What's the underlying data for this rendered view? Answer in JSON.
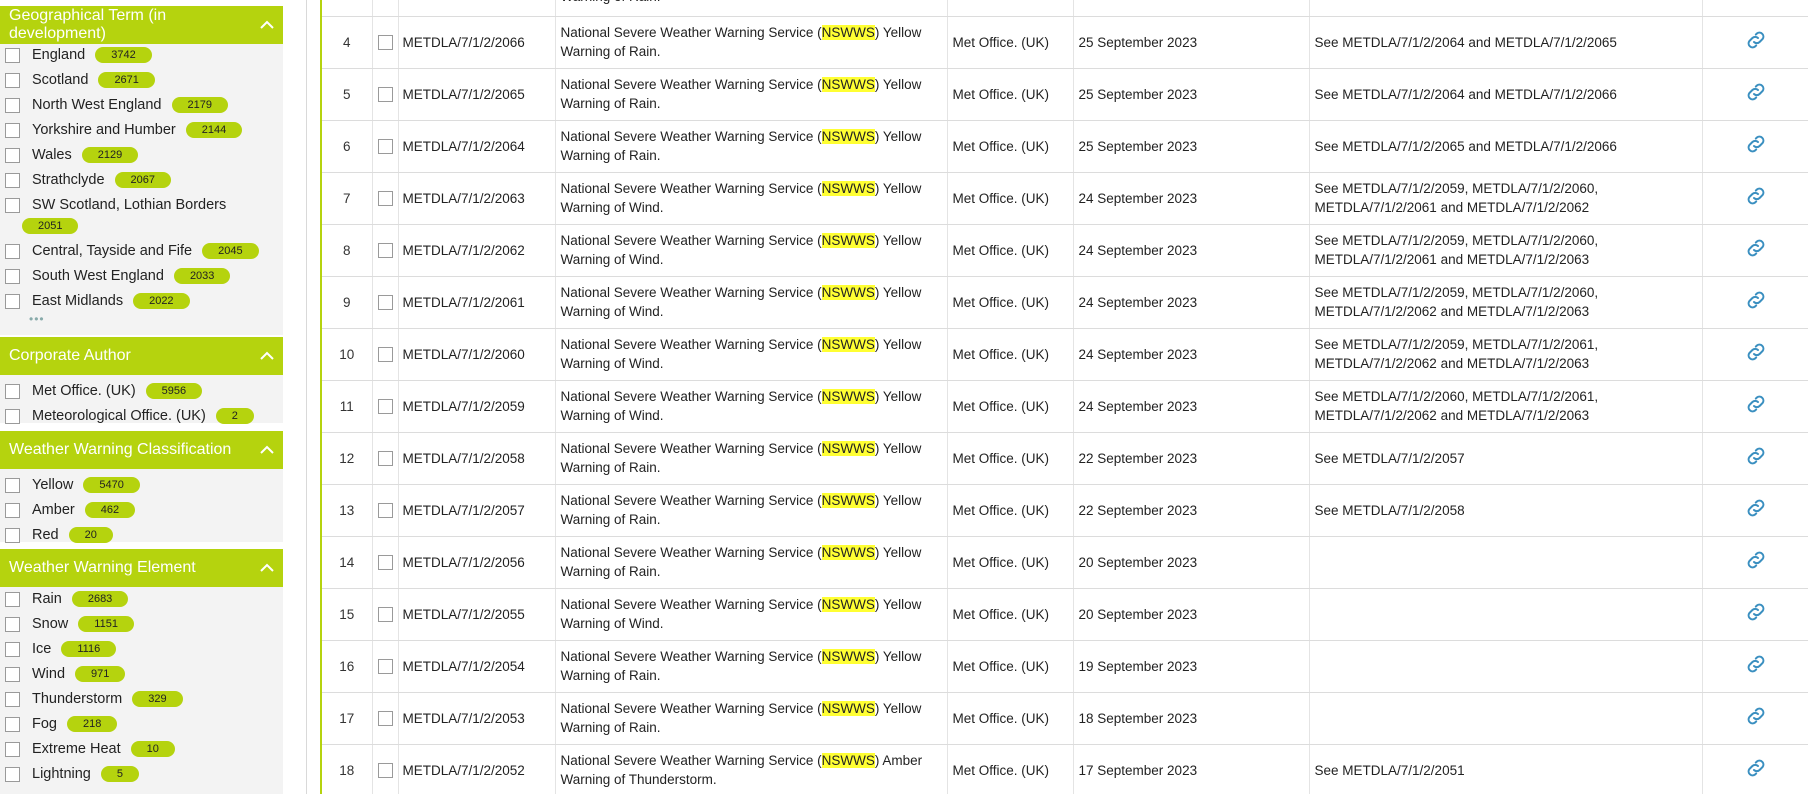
{
  "sidebar": {
    "geo": {
      "title": "Geographical Term (in development)",
      "items": [
        {
          "label": "England",
          "count": "3742"
        },
        {
          "label": "Scotland",
          "count": "2671"
        },
        {
          "label": "North West England",
          "count": "2179"
        },
        {
          "label": "Yorkshire and Humber",
          "count": "2144"
        },
        {
          "label": "Wales",
          "count": "2129"
        },
        {
          "label": "Strathclyde",
          "count": "2067"
        },
        {
          "label": "SW Scotland, Lothian Borders",
          "count": "2051"
        },
        {
          "label": "Central, Tayside and Fife",
          "count": "2045"
        },
        {
          "label": "South West England",
          "count": "2033"
        },
        {
          "label": "East Midlands",
          "count": "2022"
        }
      ],
      "more": "•••"
    },
    "author": {
      "title": "Corporate Author",
      "items": [
        {
          "label": "Met Office. (UK)",
          "count": "5956"
        },
        {
          "label": "Meteorological Office. (UK)",
          "count": "2"
        }
      ]
    },
    "classification": {
      "title": "Weather Warning Classification",
      "items": [
        {
          "label": "Yellow",
          "count": "5470"
        },
        {
          "label": "Amber",
          "count": "462"
        },
        {
          "label": "Red",
          "count": "20"
        }
      ]
    },
    "element": {
      "title": "Weather Warning Element",
      "items": [
        {
          "label": "Rain",
          "count": "2683"
        },
        {
          "label": "Snow",
          "count": "1151"
        },
        {
          "label": "Ice",
          "count": "1116"
        },
        {
          "label": "Wind",
          "count": "971"
        },
        {
          "label": "Thunderstorm",
          "count": "329"
        },
        {
          "label": "Fog",
          "count": "218"
        },
        {
          "label": "Extreme Heat",
          "count": "10"
        },
        {
          "label": "Lightning",
          "count": "5"
        }
      ]
    }
  },
  "table": {
    "partial_row_text": "Warning of Rain.",
    "title_prefix": "National Severe Weather Warning Service (",
    "title_hl": "NSWWS",
    "rows": [
      {
        "num": "4",
        "id": "METDLA/7/1/2/2066",
        "suffix": ") Yellow Warning of Rain.",
        "author": "Met Office. (UK)",
        "date": "25 September 2023",
        "rel": "See METDLA/7/1/2/2064 and METDLA/7/1/2/2065"
      },
      {
        "num": "5",
        "id": "METDLA/7/1/2/2065",
        "suffix": ") Yellow Warning of Rain.",
        "author": "Met Office. (UK)",
        "date": "25 September 2023",
        "rel": "See METDLA/7/1/2/2064 and METDLA/7/1/2/2066"
      },
      {
        "num": "6",
        "id": "METDLA/7/1/2/2064",
        "suffix": ") Yellow Warning of Rain.",
        "author": "Met Office. (UK)",
        "date": "25 September 2023",
        "rel": "See METDLA/7/1/2/2065 and METDLA/7/1/2/2066"
      },
      {
        "num": "7",
        "id": "METDLA/7/1/2/2063",
        "suffix": ") Yellow Warning of Wind.",
        "author": "Met Office. (UK)",
        "date": "24 September 2023",
        "rel": "See METDLA/7/1/2/2059, METDLA/7/1/2/2060, METDLA/7/1/2/2061 and METDLA/7/1/2/2062"
      },
      {
        "num": "8",
        "id": "METDLA/7/1/2/2062",
        "suffix": ") Yellow Warning of Wind.",
        "author": "Met Office. (UK)",
        "date": "24 September 2023",
        "rel": "See METDLA/7/1/2/2059, METDLA/7/1/2/2060, METDLA/7/1/2/2061 and METDLA/7/1/2/2063"
      },
      {
        "num": "9",
        "id": "METDLA/7/1/2/2061",
        "suffix": ") Yellow Warning of Wind.",
        "author": "Met Office. (UK)",
        "date": "24 September 2023",
        "rel": "See METDLA/7/1/2/2059, METDLA/7/1/2/2060, METDLA/7/1/2/2062 and METDLA/7/1/2/2063"
      },
      {
        "num": "10",
        "id": "METDLA/7/1/2/2060",
        "suffix": ") Yellow Warning of Wind.",
        "author": "Met Office. (UK)",
        "date": "24 September 2023",
        "rel": "See METDLA/7/1/2/2059, METDLA/7/1/2/2061, METDLA/7/1/2/2062 and METDLA/7/1/2/2063"
      },
      {
        "num": "11",
        "id": "METDLA/7/1/2/2059",
        "suffix": ") Yellow Warning of Wind.",
        "author": "Met Office. (UK)",
        "date": "24 September 2023",
        "rel": "See METDLA/7/1/2/2060, METDLA/7/1/2/2061, METDLA/7/1/2/2062 and METDLA/7/1/2/2063"
      },
      {
        "num": "12",
        "id": "METDLA/7/1/2/2058",
        "suffix": ") Yellow Warning of Rain.",
        "author": "Met Office. (UK)",
        "date": "22 September 2023",
        "rel": "See METDLA/7/1/2/2057"
      },
      {
        "num": "13",
        "id": "METDLA/7/1/2/2057",
        "suffix": ") Yellow Warning of Rain.",
        "author": "Met Office. (UK)",
        "date": "22 September 2023",
        "rel": "See METDLA/7/1/2/2058"
      },
      {
        "num": "14",
        "id": "METDLA/7/1/2/2056",
        "suffix": ") Yellow Warning of Rain.",
        "author": "Met Office. (UK)",
        "date": "20 September 2023",
        "rel": ""
      },
      {
        "num": "15",
        "id": "METDLA/7/1/2/2055",
        "suffix": ") Yellow Warning of Wind.",
        "author": "Met Office. (UK)",
        "date": "20 September 2023",
        "rel": ""
      },
      {
        "num": "16",
        "id": "METDLA/7/1/2/2054",
        "suffix": ") Yellow Warning of Rain.",
        "author": "Met Office. (UK)",
        "date": "19 September 2023",
        "rel": ""
      },
      {
        "num": "17",
        "id": "METDLA/7/1/2/2053",
        "suffix": ") Yellow Warning of Rain.",
        "author": "Met Office. (UK)",
        "date": "18 September 2023",
        "rel": ""
      },
      {
        "num": "18",
        "id": "METDLA/7/1/2/2052",
        "suffix": ") Amber Warning of Thunderstorm.",
        "author": "Met Office. (UK)",
        "date": "17 September 2023",
        "rel": "See METDLA/7/1/2/2051"
      }
    ]
  },
  "colors": {
    "accent": "#b5d30e",
    "highlight": "#ffff33",
    "link_icon": "#3a8fc0"
  }
}
